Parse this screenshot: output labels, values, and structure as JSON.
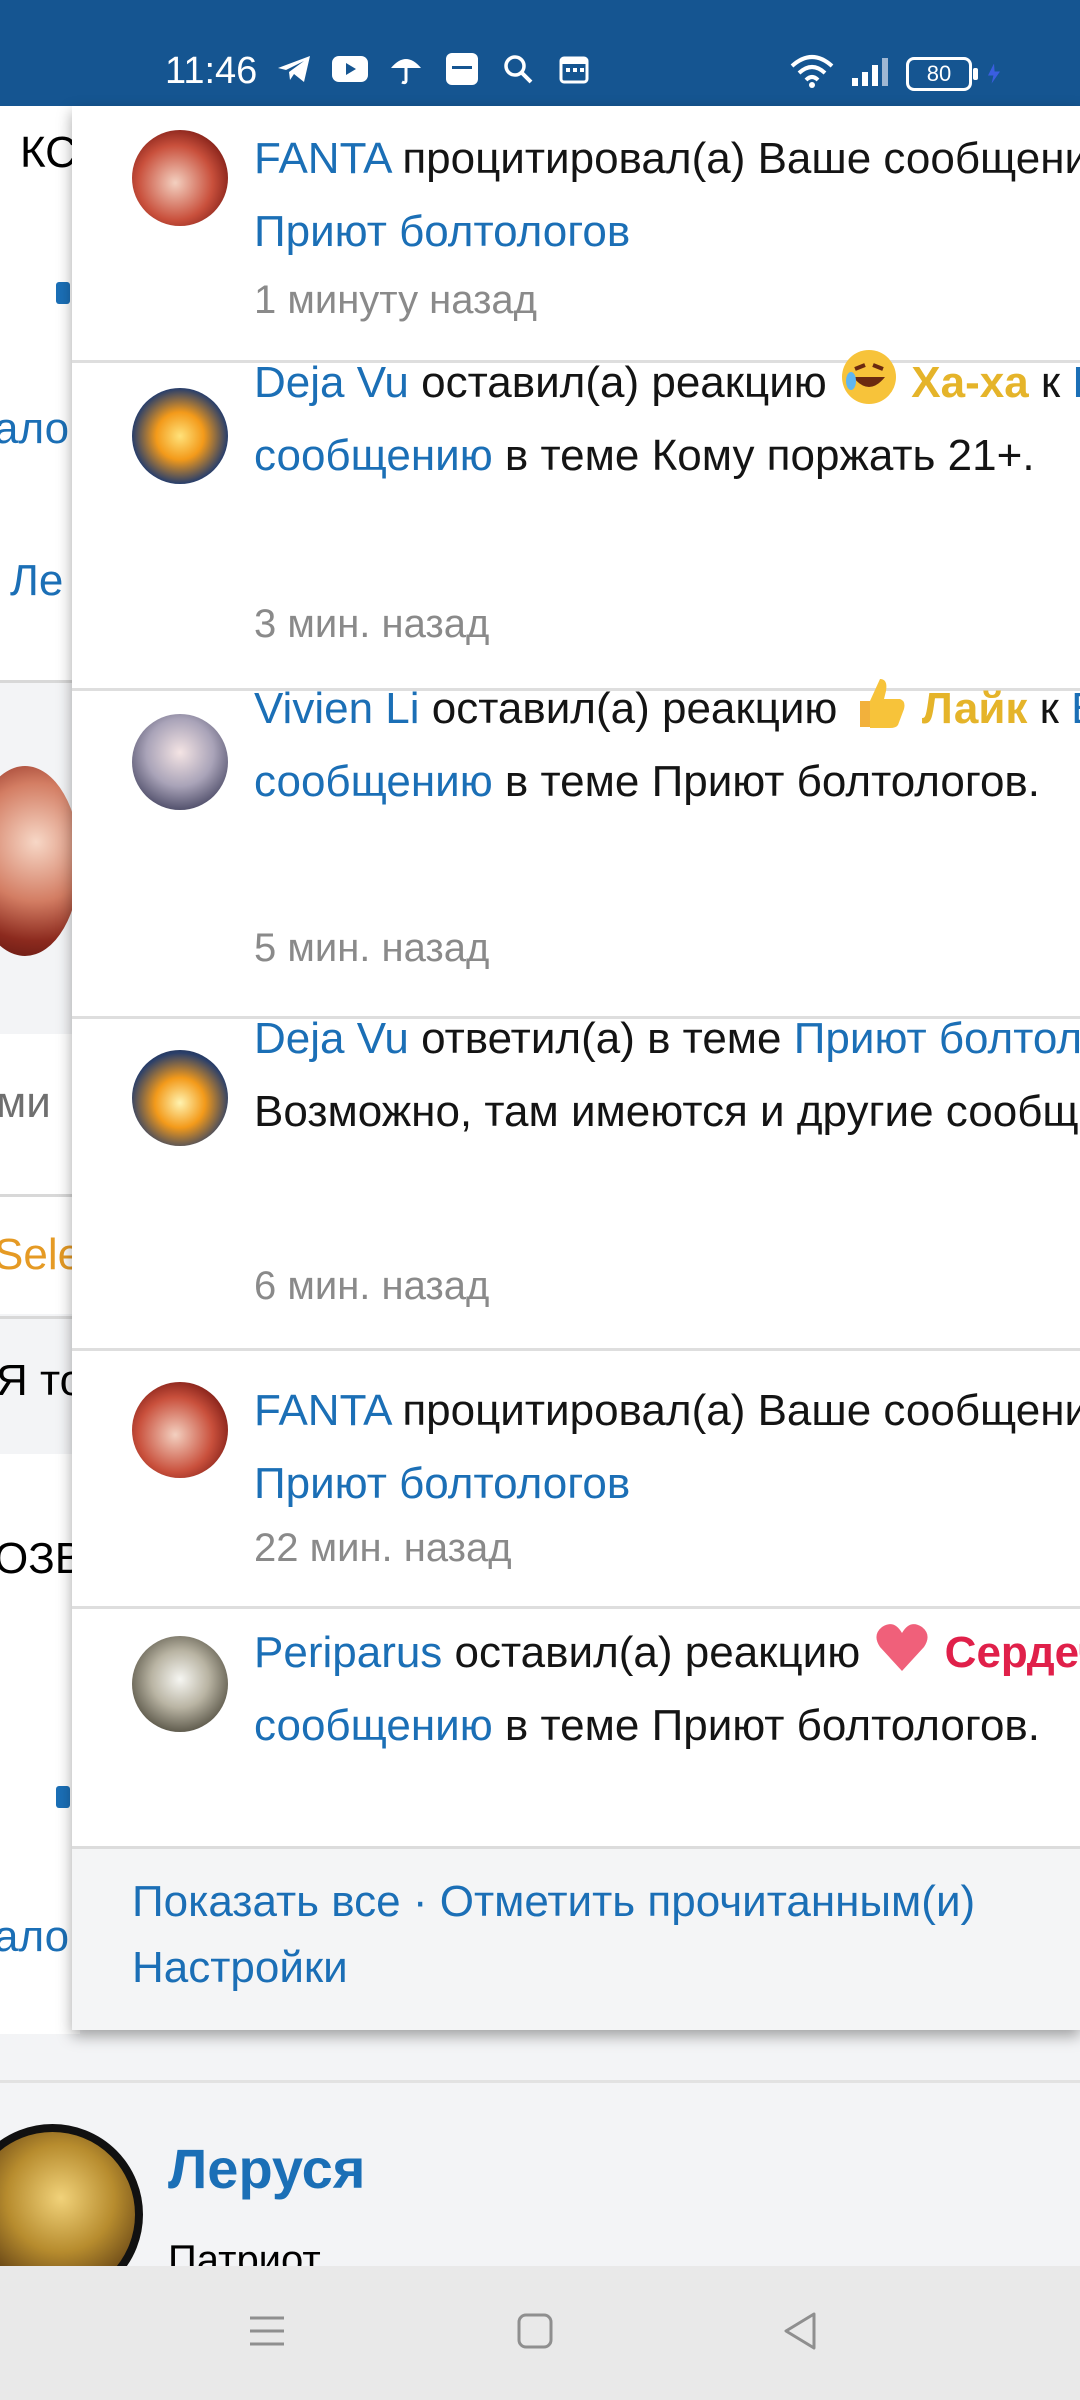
{
  "status_bar": {
    "time": "11:46",
    "battery": "80",
    "icons": [
      "telegram-icon",
      "youtube-icon",
      "umbrella-icon",
      "app-badge-icon",
      "search-icon",
      "calendar-icon"
    ],
    "right_icons": [
      "wifi-icon",
      "signal-icon",
      "battery-icon",
      "charging-icon"
    ]
  },
  "background_page": {
    "fragments": [
      "КС",
      "ало",
      "Ле",
      "ми",
      "Sele",
      "Я то",
      "ОЗВ",
      "ало"
    ],
    "profile": {
      "name": "Леруся",
      "role": "Патриот"
    }
  },
  "notifications": [
    {
      "user": "FANTA",
      "action": " процитировал(а) Ваше сообщение в теме ",
      "link": "Приют болтологов",
      "tail": "",
      "time": "1 минуту назад",
      "avatar": "santa-girl-avatar"
    },
    {
      "user": "Deja Vu",
      "action": " оставил(а) реакцию ",
      "reaction_emoji": "rofl-emoji",
      "reaction": "Ха-ха",
      "mid": " к ",
      "link": "Вашему сообщению",
      "tail": " в теме Кому поржать 21+.",
      "time": "3 мин. назад",
      "avatar": "sun-orb-avatar"
    },
    {
      "user": "Vivien Li",
      "action": " оставил(а) реакцию ",
      "reaction_emoji": "thumbs-up-emoji",
      "reaction": "Лайк",
      "mid": " к ",
      "link": "Вашему сообщению",
      "tail": " в теме Приют болтологов.",
      "time": "5 мин. назад",
      "avatar": "anime-girl-avatar"
    },
    {
      "user": "Deja Vu",
      "action": " ответил(а) в теме ",
      "link": "Приют болтологов",
      "tail": ". Возможно, там имеются и другие сообщения.",
      "time": "6 мин. назад",
      "avatar": "sun-orb-avatar"
    },
    {
      "user": "FANTA",
      "action": " процитировал(а) Ваше сообщение в теме ",
      "link": "Приют болтологов",
      "tail": "",
      "time": "22 мин. назад",
      "avatar": "santa-girl-avatar"
    },
    {
      "user": "Periparus",
      "action": " оставил(а) реакцию ",
      "reaction_emoji": "heart-emoji",
      "reaction": "Сердечко",
      "mid": " к ",
      "link": "Вашему сообщению",
      "tail": " в теме Приют болтологов.",
      "time": "",
      "avatar": "bird-avatar"
    }
  ],
  "footer": {
    "show_all": "Показать все",
    "separator": " · ",
    "mark_read": "Отметить прочитанным(и)",
    "settings": "Настройки"
  },
  "colors": {
    "status_bar": "#155591",
    "link": "#1b6fb6",
    "time_gray": "#8a8a8a",
    "reaction_red": "#e0204a",
    "reaction_yellow": "#e5b42a"
  }
}
